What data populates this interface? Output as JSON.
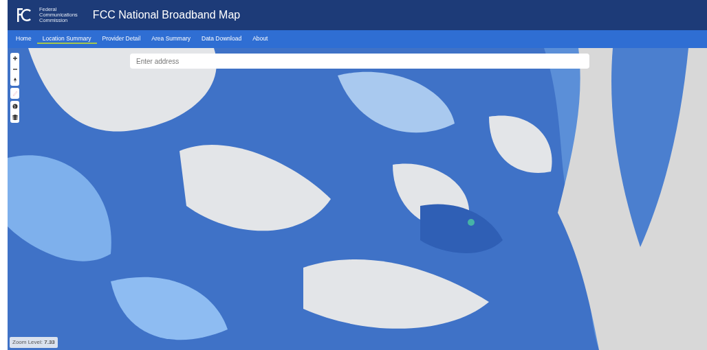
{
  "header": {
    "agency_lines": [
      "Federal",
      "Communications",
      "Commission"
    ],
    "title": "FCC National Broadband Map"
  },
  "nav": [
    {
      "label": "Home",
      "selected": false
    },
    {
      "label": "Location Summary",
      "selected": true
    },
    {
      "label": "Provider Detail",
      "selected": false
    },
    {
      "label": "Area Summary",
      "selected": false
    },
    {
      "label": "Data Download",
      "selected": false
    },
    {
      "label": "About",
      "selected": false
    }
  ],
  "map": {
    "search": {
      "placeholder": "Enter address"
    },
    "controls": [
      {
        "kind": "zoom-in",
        "disabled": false
      },
      {
        "kind": "zoom-out",
        "disabled": false
      },
      {
        "kind": "compass",
        "disabled": false
      },
      {
        "kind": "draw",
        "disabled": true
      },
      {
        "kind": "globe",
        "disabled": false
      },
      {
        "kind": "layers",
        "disabled": false
      }
    ],
    "zoom_level": "Zoom Level: **7.33**"
  }
}
